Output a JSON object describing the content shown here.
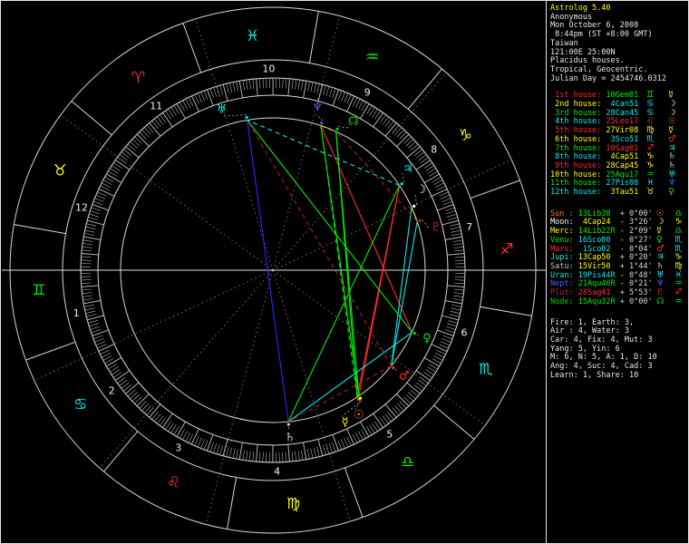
{
  "header": {
    "title": "Astrolog 5.40",
    "subject": "Anonymous",
    "date": "Mon October 6, 2008",
    "time": " 8:44pm (ST +8:00 GMT)",
    "location": "Taiwan",
    "coordinates": "121:00E 25:00N",
    "house_system": "Placidus houses.",
    "zodiac_type": "Tropical, Geocentric.",
    "julian_day": "Julian Day = 2454746.0312"
  },
  "colors": {
    "background": "#000000",
    "foreground": "#e8e8e8",
    "title": "#ffff00",
    "wheel_line": "#d8d8d8",
    "cusp_dotted": "#8a8a8a",
    "elements": {
      "fire": "#ff2a2a",
      "earth": "#ffff00",
      "air": "#00ee00",
      "water": "#00eeee"
    }
  },
  "houses": [
    {
      "number": "1",
      "label": " 1st house:",
      "pos": "10Gem01",
      "lon": 70.017,
      "element": "air",
      "label_element": "fire",
      "sign_glyph": "♊",
      "ruler_glyph": "☿",
      "ruler_color": "#ffff00"
    },
    {
      "number": "2",
      "label": " 2nd house:",
      "pos": " 4Can51",
      "lon": 94.85,
      "element": "water",
      "label_element": "earth",
      "sign_glyph": "♋",
      "ruler_glyph": "☽",
      "ruler_color": "#ffffff"
    },
    {
      "number": "3",
      "label": " 3rd house:",
      "pos": "28Can45",
      "lon": 118.75,
      "element": "water",
      "label_element": "air",
      "sign_glyph": "♋",
      "ruler_glyph": "☽",
      "ruler_color": "#ffffff"
    },
    {
      "number": "4",
      "label": " 4th house:",
      "pos": "25Leo17",
      "lon": 145.283,
      "element": "fire",
      "label_element": "water",
      "sign_glyph": "♌",
      "ruler_glyph": "☉",
      "ruler_color": "#ff8000"
    },
    {
      "number": "5",
      "label": " 5th house:",
      "pos": "27Vir08",
      "lon": 177.133,
      "element": "earth",
      "label_element": "fire",
      "sign_glyph": "♍",
      "ruler_glyph": "☿",
      "ruler_color": "#ffff00"
    },
    {
      "number": "6",
      "label": " 6th house:",
      "pos": " 3Sco51",
      "lon": 213.85,
      "element": "water",
      "label_element": "earth",
      "sign_glyph": "♏",
      "ruler_glyph": "♂",
      "ruler_color": "#ff2a2a"
    },
    {
      "number": "7",
      "label": " 7th house:",
      "pos": "10Sag01",
      "lon": 250.017,
      "element": "fire",
      "label_element": "air",
      "sign_glyph": "♐",
      "ruler_glyph": "♃",
      "ruler_color": "#00eeee"
    },
    {
      "number": "8",
      "label": " 8th house:",
      "pos": " 4Cap51",
      "lon": 274.85,
      "element": "earth",
      "label_element": "water",
      "sign_glyph": "♑",
      "ruler_glyph": "♄",
      "ruler_color": "#c8c8c8"
    },
    {
      "number": "9",
      "label": " 9th house:",
      "pos": "28Cap45",
      "lon": 298.75,
      "element": "earth",
      "label_element": "fire",
      "sign_glyph": "♑",
      "ruler_glyph": "♄",
      "ruler_color": "#c8c8c8"
    },
    {
      "number": "10",
      "label": "10th house:",
      "pos": "25Aqu17",
      "lon": 325.283,
      "element": "air",
      "label_element": "earth",
      "sign_glyph": "♒",
      "ruler_glyph": "♅",
      "ruler_color": "#00eeee"
    },
    {
      "number": "11",
      "label": "11th house:",
      "pos": "27Pis08",
      "lon": 357.133,
      "element": "water",
      "label_element": "air",
      "sign_glyph": "♓",
      "ruler_glyph": "♆",
      "ruler_color": "#5858ff"
    },
    {
      "number": "12",
      "label": "12th house:",
      "pos": " 3Tau51",
      "lon": 33.85,
      "element": "earth",
      "label_element": "water",
      "sign_glyph": "♉",
      "ruler_glyph": "♀",
      "ruler_color": "#00ee00"
    }
  ],
  "planets": [
    {
      "name": "sun",
      "label": "Sun : ",
      "pos": "13Lib38 ",
      "lat": " + 0°00'",
      "lon": 193.633,
      "disp": -3,
      "glyph": "☉",
      "sign_glyph": "♎",
      "sign_element": "air",
      "color": "#ff8000"
    },
    {
      "name": "moon",
      "label": "Moon: ",
      "pos": " 4Cap24 ",
      "lat": " - 3°26'",
      "lon": 274.4,
      "disp": 4,
      "glyph": "☽",
      "sign_glyph": "♑",
      "sign_element": "earth",
      "color": "#ffffff"
    },
    {
      "name": "mercury",
      "label": "Merc: ",
      "pos": "14Lib22R",
      "lat": " - 2°09'",
      "lon": 194.367,
      "disp": -9,
      "glyph": "☿",
      "sign_glyph": "♎",
      "sign_element": "air",
      "color": "#ffff00"
    },
    {
      "name": "venus",
      "label": "Venu: ",
      "pos": "16Sco00 ",
      "lat": " - 0°27'",
      "lon": 226.0,
      "disp": 0,
      "glyph": "♀",
      "sign_glyph": "♏",
      "sign_element": "water",
      "color": "#00ee00"
    },
    {
      "name": "mars",
      "label": "Mars: ",
      "pos": " 1Sco02 ",
      "lat": " - 0°04'",
      "lon": 211.033,
      "disp": 0,
      "glyph": "♂",
      "sign_glyph": "♏",
      "sign_element": "water",
      "color": "#ff2a2a"
    },
    {
      "name": "jupiter",
      "label": "Jupi: ",
      "pos": "13Cap50 ",
      "lat": " + 0°20'",
      "lon": 283.833,
      "disp": 3,
      "glyph": "♃",
      "sign_glyph": "♑",
      "sign_element": "earth",
      "color": "#00eeee"
    },
    {
      "name": "saturn",
      "label": "Satu: ",
      "pos": "15Vir50 ",
      "lat": " + 1°44'",
      "lon": 165.833,
      "disp": 0,
      "glyph": "♄",
      "sign_glyph": "♍",
      "sign_element": "earth",
      "color": "#c8c8c8"
    },
    {
      "name": "uranus",
      "label": "Uran: ",
      "pos": "19Pis44R",
      "lat": " - 0°48'",
      "lon": 349.733,
      "disp": 8,
      "glyph": "♅",
      "sign_glyph": "♓",
      "sign_element": "water",
      "color": "#00eeee"
    },
    {
      "name": "neptune",
      "label": "Nept: ",
      "pos": "21Aqu40R",
      "lat": " - 0°21'",
      "lon": 321.667,
      "disp": 3,
      "glyph": "♆",
      "sign_glyph": "♒",
      "sign_element": "air",
      "color": "#5858ff"
    },
    {
      "name": "pluto",
      "label": "Plut: ",
      "pos": "28Sag41 ",
      "lat": " + 5°53'",
      "lon": 268.683,
      "disp": -4,
      "glyph": "♇",
      "sign_glyph": "♐",
      "sign_element": "fire",
      "color": "#d02020"
    },
    {
      "name": "node",
      "label": "Node: ",
      "pos": "15Aqu32R",
      "lat": " + 0°00'",
      "lon": 315.533,
      "disp": -4,
      "glyph": "☊",
      "sign_glyph": "♒",
      "sign_element": "air",
      "color": "#00d000"
    }
  ],
  "signs": [
    {
      "name": "Aries",
      "glyph": "♈",
      "element": "fire"
    },
    {
      "name": "Taurus",
      "glyph": "♉",
      "element": "earth"
    },
    {
      "name": "Gemini",
      "glyph": "♊",
      "element": "air"
    },
    {
      "name": "Cancer",
      "glyph": "♋",
      "element": "water"
    },
    {
      "name": "Leo",
      "glyph": "♌",
      "element": "fire"
    },
    {
      "name": "Virgo",
      "glyph": "♍",
      "element": "earth"
    },
    {
      "name": "Libra",
      "glyph": "♎",
      "element": "air"
    },
    {
      "name": "Scorpio",
      "glyph": "♏",
      "element": "water"
    },
    {
      "name": "Sagittarius",
      "glyph": "♐",
      "element": "fire"
    },
    {
      "name": "Capricorn",
      "glyph": "♑",
      "element": "earth"
    },
    {
      "name": "Aquarius",
      "glyph": "♒",
      "element": "air"
    },
    {
      "name": "Pisces",
      "glyph": "♓",
      "element": "water"
    }
  ],
  "aspects": [
    {
      "p": [
        6,
        7
      ],
      "type": "opposition",
      "color": "#2828ff",
      "dashed": false
    },
    {
      "p": [
        0,
        5
      ],
      "type": "square",
      "color": "#ff2a2a",
      "dashed": false
    },
    {
      "p": [
        2,
        5
      ],
      "type": "square",
      "color": "#ff2a2a",
      "dashed": false
    },
    {
      "p": [
        3,
        8
      ],
      "type": "square",
      "color": "#ff2a2a",
      "dashed": false
    },
    {
      "p": [
        0,
        10
      ],
      "type": "trine",
      "color": "#00ee00",
      "dashed": false
    },
    {
      "p": [
        2,
        10
      ],
      "type": "trine",
      "color": "#00ee00",
      "dashed": false
    },
    {
      "p": [
        2,
        8
      ],
      "type": "trine",
      "color": "#00ee00",
      "dashed": false
    },
    {
      "p": [
        5,
        6
      ],
      "type": "trine",
      "color": "#00ee00",
      "dashed": false
    },
    {
      "p": [
        3,
        7
      ],
      "type": "trine",
      "color": "#00ee00",
      "dashed": false
    },
    {
      "p": [
        0,
        8
      ],
      "type": "trine",
      "color": "#00ee00",
      "dashed": true
    },
    {
      "p": [
        3,
        6
      ],
      "type": "sextile",
      "color": "#00eeee",
      "dashed": false
    },
    {
      "p": [
        1,
        4
      ],
      "type": "sextile",
      "color": "#00eeee",
      "dashed": false
    },
    {
      "p": [
        4,
        9
      ],
      "type": "sextile",
      "color": "#00eeee",
      "dashed": false
    },
    {
      "p": [
        5,
        7
      ],
      "type": "sextile",
      "color": "#00eeee",
      "dashed": true
    },
    {
      "p": [
        1,
        9
      ],
      "type": "conjunction",
      "color": "#eeee00",
      "dashed": false
    },
    {
      "p": [
        0,
        2
      ],
      "type": "conjunction",
      "color": "#eeee00",
      "dashed": false
    },
    {
      "p": [
        8,
        10
      ],
      "type": "conjunction",
      "color": "#eeee00",
      "dashed": true
    },
    {
      "p": [
        4,
        6
      ],
      "type": "semisquare",
      "color": "#a82020",
      "dashed": true
    },
    {
      "p": [
        9,
        10
      ],
      "type": "semisquare",
      "color": "#a82020",
      "dashed": true
    },
    {
      "p": [
        4,
        7
      ],
      "type": "sesquiquadrate",
      "color": "#a82020",
      "dashed": true
    }
  ],
  "stats": [
    "Fire: 1, Earth: 3,",
    "Air : 4, Water: 3",
    "Car: 4, Fix: 4, Mut: 3",
    "Yang: 5, Yin: 6",
    "M: 6, N: 5, A: 1, D: 10",
    "Ang: 4, Suc: 4, Cad: 3",
    "Learn: 1, Share: 10"
  ]
}
